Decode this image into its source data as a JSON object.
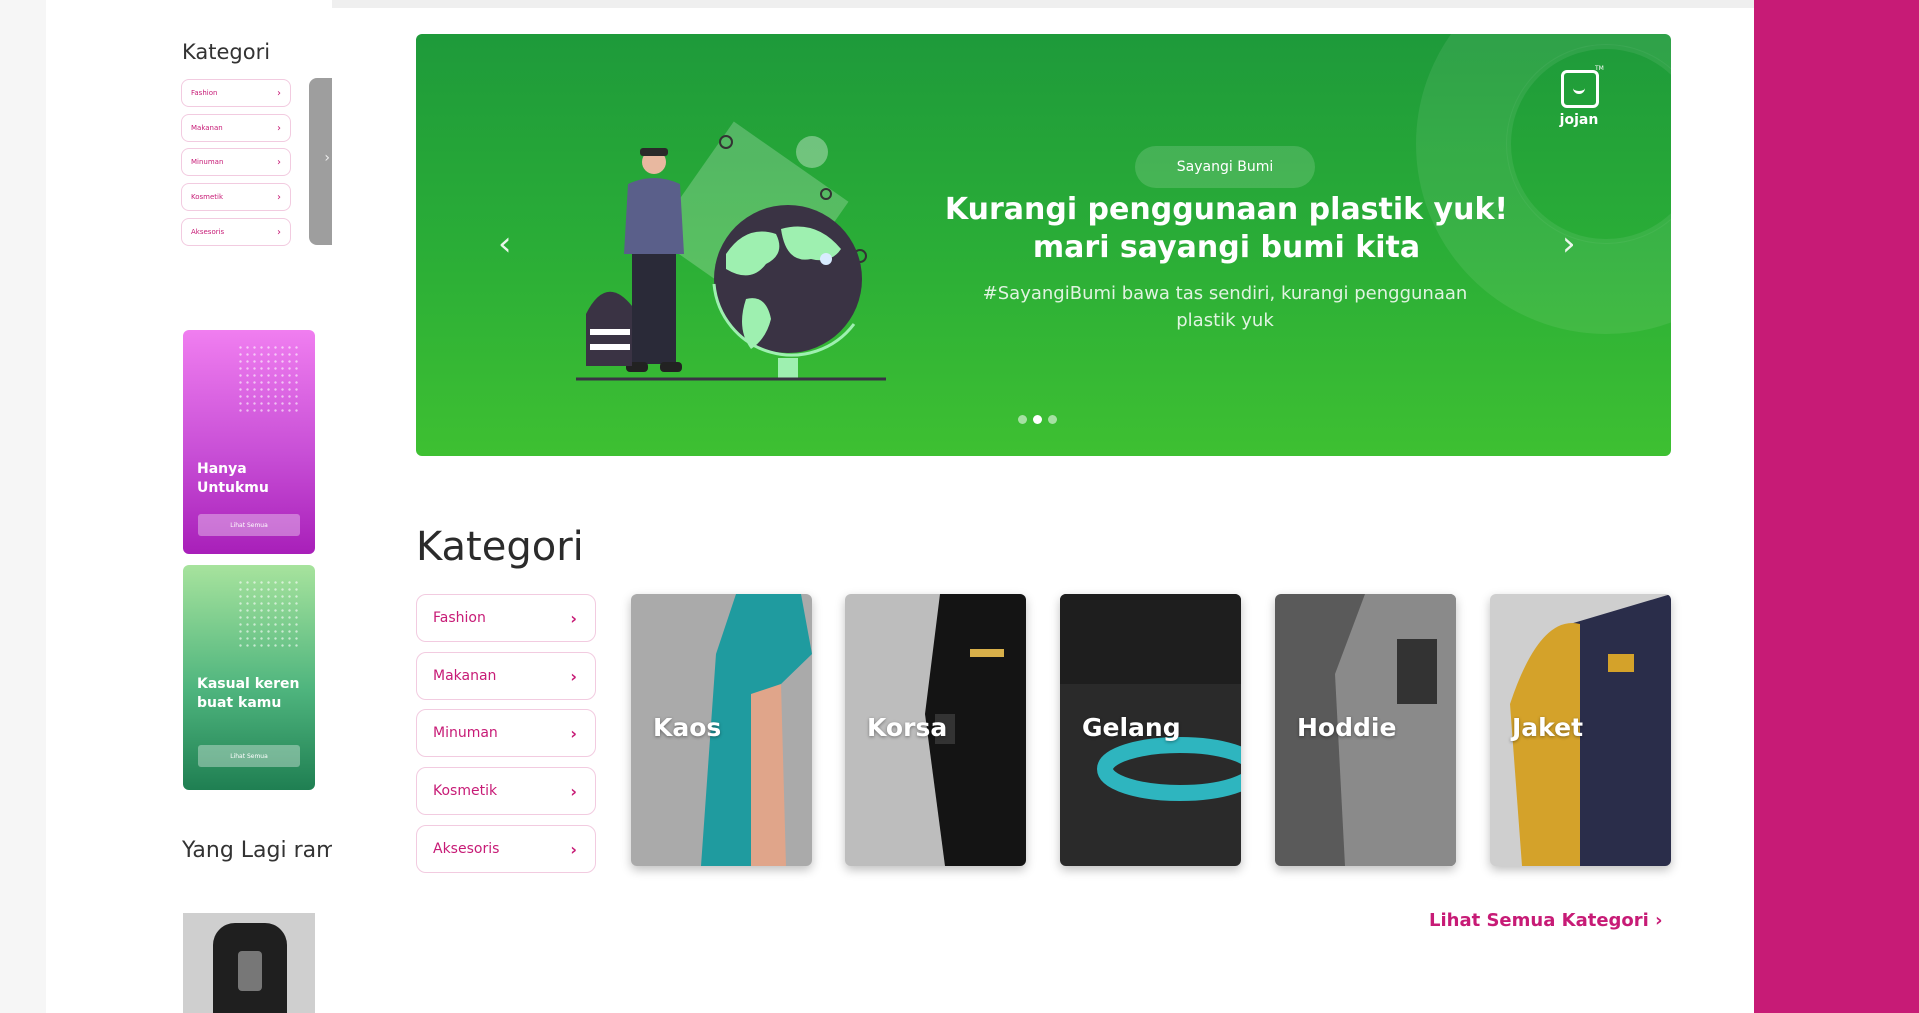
{
  "sidebar": {
    "title": "Kategori",
    "categories": [
      {
        "label": "Fashion"
      },
      {
        "label": "Makanan"
      },
      {
        "label": "Minuman"
      },
      {
        "label": "Kosmetik"
      },
      {
        "label": "Aksesoris"
      }
    ],
    "promos": [
      {
        "text": "Hanya Untukmu",
        "button": "Lihat Semua",
        "color_top": "#f07ef0",
        "color_bottom": "#a81fb9"
      },
      {
        "text": "Kasual keren buat kamu",
        "button": "Lihat Semua",
        "color_top": "#a7e39d",
        "color_bottom": "#1f7f52"
      }
    ],
    "trending_title": "Yang Lagi ramai diminati"
  },
  "banner": {
    "pill": "Sayangi Bumi",
    "headline": "Kurangi penggunaan plastik yuk! mari sayangi bumi kita",
    "subtext": "#SayangiBumi bawa tas sendiri, kurangi penggunaan plastik yuk",
    "brand": "jojan",
    "active_slide": 2,
    "slide_count": 3,
    "prev_icon": "chevron-left-icon",
    "next_icon": "chevron-right-icon"
  },
  "main": {
    "category_title": "Kategori",
    "categories": [
      {
        "label": "Fashion"
      },
      {
        "label": "Makanan"
      },
      {
        "label": "Minuman"
      },
      {
        "label": "Kosmetik"
      },
      {
        "label": "Aksesoris"
      }
    ],
    "cards": [
      {
        "label": "Kaos"
      },
      {
        "label": "Korsa"
      },
      {
        "label": "Gelang"
      },
      {
        "label": "Hoddie"
      },
      {
        "label": "Jaket"
      }
    ],
    "see_all": "Lihat Semua Kategori ›"
  },
  "colors": {
    "accent": "#c71b76",
    "banner_green": "#2aad37"
  }
}
